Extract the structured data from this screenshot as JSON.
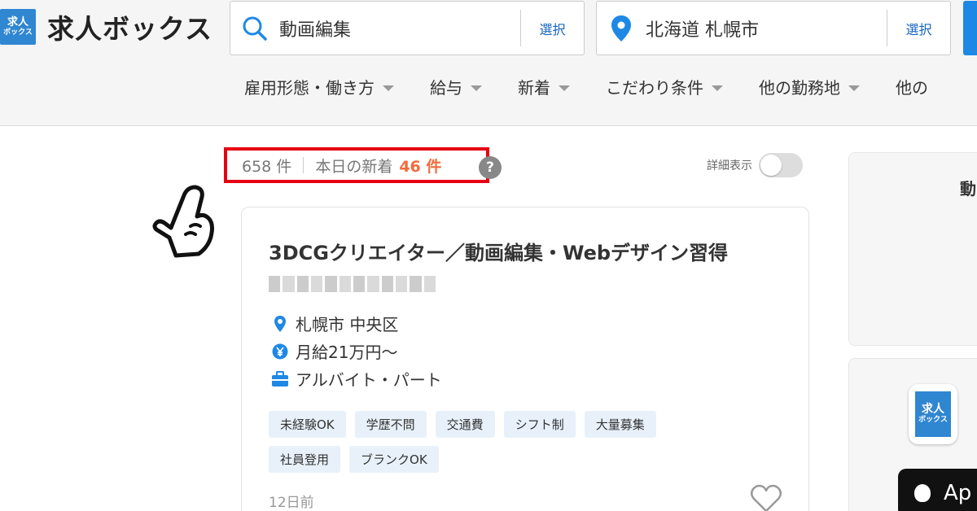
{
  "header": {
    "logo_square_line1": "求人",
    "logo_square_line2": "ボックス",
    "logo_text": "求人ボックス",
    "keyword": {
      "value": "動画編集",
      "select_label": "選択"
    },
    "location": {
      "value": "北海道 札幌市",
      "select_label": "選択"
    },
    "filters": [
      {
        "label": "雇用形態・働き方"
      },
      {
        "label": "給与"
      },
      {
        "label": "新着"
      },
      {
        "label": "こだわり条件"
      },
      {
        "label": "他の勤務地"
      },
      {
        "label": "他の"
      }
    ]
  },
  "results": {
    "count": "658 件",
    "new_today_label": "本日の新着",
    "new_today_count": "46 件",
    "help": "?",
    "detail_toggle_label": "詳細表示",
    "detail_toggle_on": false
  },
  "job": {
    "title": "3DCGクリエイター／動画編集・Webデザイン習得",
    "location": "札幌市 中央区",
    "salary": "月給21万円〜",
    "employment": "アルバイト・パート",
    "tags": [
      "未経験OK",
      "学歴不問",
      "交通費",
      "シフト制",
      "大量募集",
      "社員登用",
      "ブランクOK"
    ],
    "posted": "12日前"
  },
  "sidebar": {
    "card_title": "動",
    "app_icon_line1": "求人",
    "app_icon_line2": "ボックス",
    "appstore_text": "Ap"
  },
  "colors": {
    "brand_blue": "#2f86d1",
    "link_blue": "#1565c0",
    "highlight_red": "#e60012",
    "new_count_orange": "#f26b3a",
    "tag_bg": "#e8f1fa"
  }
}
